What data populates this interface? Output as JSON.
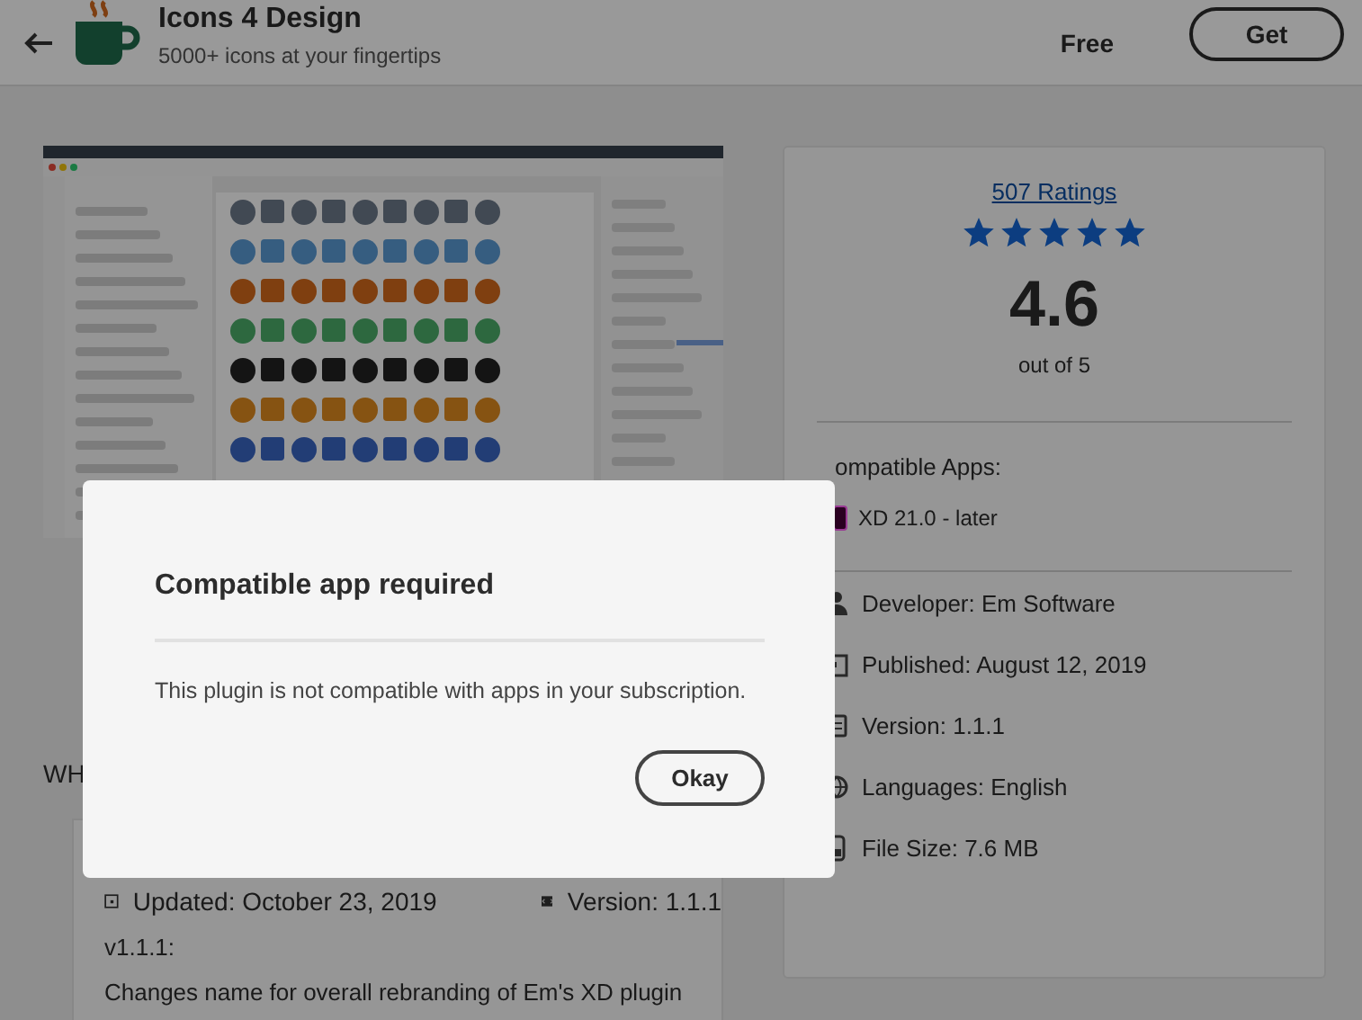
{
  "header": {
    "title": "Icons 4 Design",
    "subtitle": "5000+ icons at your fingertips",
    "price": "Free",
    "get_button": "Get"
  },
  "ratings": {
    "link": "507 Ratings",
    "stars": 5,
    "score": "4.6",
    "scale": "out of 5"
  },
  "compatible": {
    "heading": "ompatible Apps:",
    "apps": [
      {
        "label": "XD 21.0 - later"
      }
    ]
  },
  "details": [
    {
      "kind": "developer",
      "text": "Developer: Em Software"
    },
    {
      "kind": "published",
      "text": "Published: August 12, 2019"
    },
    {
      "kind": "version",
      "text": "Version: 1.1.1"
    },
    {
      "kind": "languages",
      "text": "Languages: English"
    },
    {
      "kind": "size",
      "text": "File Size: 7.6 MB"
    }
  ],
  "whats_new": {
    "heading": "WH",
    "updated": "Updated: October 23, 2019",
    "version": "Version: 1.1.1",
    "notes_title": "v1.1.1:",
    "notes": "Changes name for overall rebranding of Em's XD plugin"
  },
  "dialog": {
    "title": "Compatible app required",
    "message": "This plugin is not compatible with apps in your subscription.",
    "button": "Okay"
  }
}
